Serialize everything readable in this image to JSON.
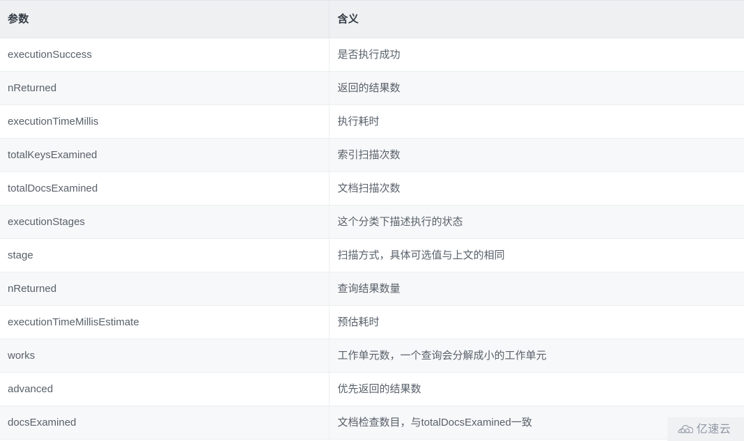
{
  "table": {
    "columns": [
      {
        "key": "param",
        "label": "参数"
      },
      {
        "key": "meaning",
        "label": "含义"
      }
    ],
    "rows": [
      {
        "param": "executionSuccess",
        "meaning": "是否执行成功"
      },
      {
        "param": "nReturned",
        "meaning": "返回的结果数"
      },
      {
        "param": "executionTimeMillis",
        "meaning": "执行耗时"
      },
      {
        "param": "totalKeysExamined",
        "meaning": "索引扫描次数"
      },
      {
        "param": "totalDocsExamined",
        "meaning": "文档扫描次数"
      },
      {
        "param": "executionStages",
        "meaning": "这个分类下描述执行的状态"
      },
      {
        "param": "stage",
        "meaning": "扫描方式，具体可选值与上文的相同"
      },
      {
        "param": "nReturned",
        "meaning": "查询结果数量"
      },
      {
        "param": "executionTimeMillisEstimate",
        "meaning": "预估耗时"
      },
      {
        "param": "works",
        "meaning": "工作单元数，一个查询会分解成小的工作单元"
      },
      {
        "param": "advanced",
        "meaning": "优先返回的结果数"
      },
      {
        "param": "docsExamined",
        "meaning": "文档检查数目，与totalDocsExamined一致"
      }
    ]
  },
  "watermark": {
    "icon": "cloud-logo-icon",
    "text": "亿速云"
  },
  "colors": {
    "header_background": "#eef0f2",
    "header_text": "#333a42",
    "body_text": "#58606a",
    "row_stripe": "#f7f8f9",
    "row_base": "#ffffff",
    "border": "#ebeef0",
    "watermark_background": "#eff1f3",
    "watermark_text": "#8f96a3"
  }
}
